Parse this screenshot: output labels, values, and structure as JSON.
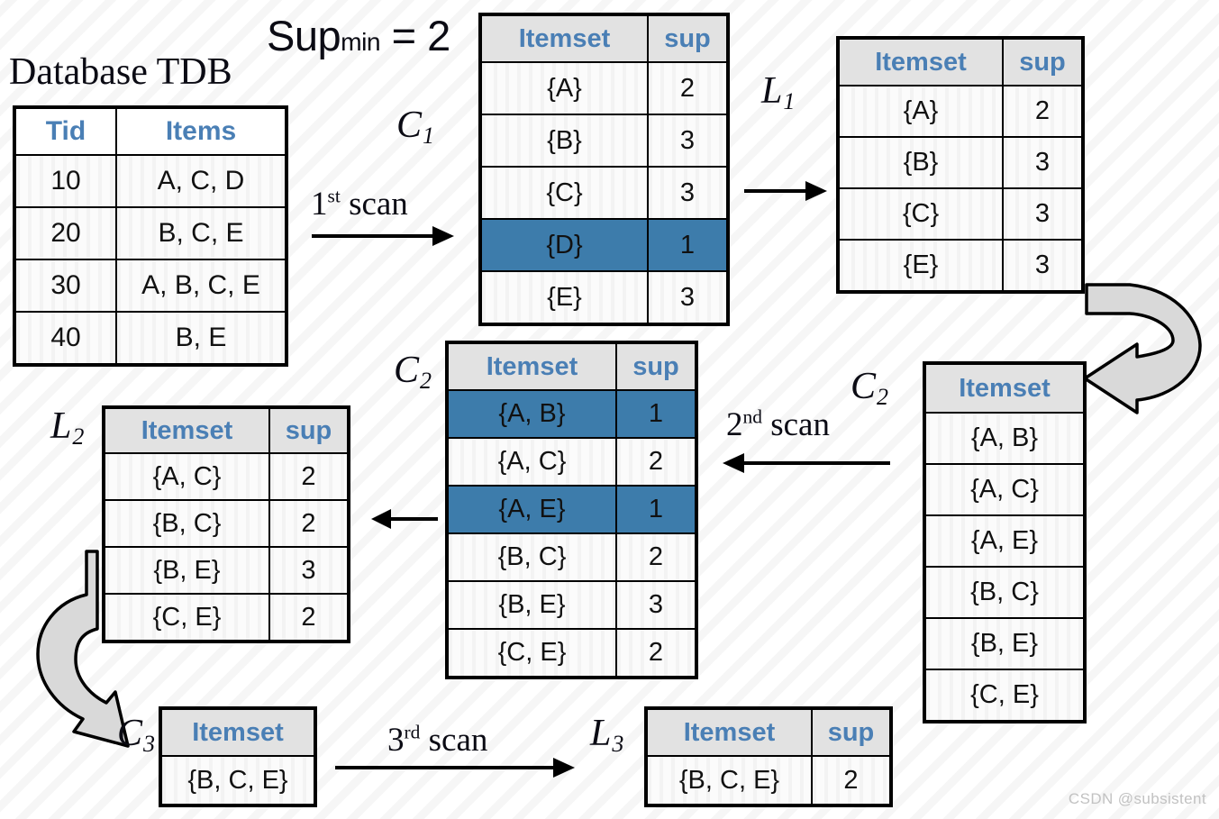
{
  "headline": {
    "database_title": "Database TDB",
    "supmin_text": "Sup",
    "supmin_sub": "min",
    "supmin_eq": " = 2"
  },
  "labels": {
    "c1": "C",
    "c1_sub": "1",
    "l1": "L",
    "l1_sub": "1",
    "c2_mid": "C",
    "c2_mid_sub": "2",
    "c2_right": "C",
    "c2_right_sub": "2",
    "l2": "L",
    "l2_sub": "2",
    "c3": "C",
    "c3_sub": "3",
    "l3": "L",
    "l3_sub": "3"
  },
  "scans": {
    "first": "1",
    "first_sup": "st",
    "first_rest": " scan",
    "second": "2",
    "second_sup": "nd",
    "second_rest": " scan",
    "third": "3",
    "third_sup": "rd",
    "third_rest": " scan"
  },
  "tdb": {
    "headers": [
      "Tid",
      "Items"
    ],
    "rows": [
      {
        "tid": "10",
        "items": "A, C, D"
      },
      {
        "tid": "20",
        "items": "B, C, E"
      },
      {
        "tid": "30",
        "items": "A, B, C, E"
      },
      {
        "tid": "40",
        "items": "B, E"
      }
    ]
  },
  "c1_table": {
    "headers": [
      "Itemset",
      "sup"
    ],
    "rows": [
      {
        "itemset": "{A}",
        "sup": "2",
        "pruned": false
      },
      {
        "itemset": "{B}",
        "sup": "3",
        "pruned": false
      },
      {
        "itemset": "{C}",
        "sup": "3",
        "pruned": false
      },
      {
        "itemset": "{D}",
        "sup": "1",
        "pruned": true
      },
      {
        "itemset": "{E}",
        "sup": "3",
        "pruned": false
      }
    ]
  },
  "l1_table": {
    "headers": [
      "Itemset",
      "sup"
    ],
    "rows": [
      {
        "itemset": "{A}",
        "sup": "2",
        "pruned": false
      },
      {
        "itemset": "{B}",
        "sup": "3",
        "pruned": false
      },
      {
        "itemset": "{C}",
        "sup": "3",
        "pruned": false
      },
      {
        "itemset": "{E}",
        "sup": "3",
        "pruned": false
      }
    ]
  },
  "c2_counted_table": {
    "headers": [
      "Itemset",
      "sup"
    ],
    "rows": [
      {
        "itemset": "{A, B}",
        "sup": "1",
        "pruned": true
      },
      {
        "itemset": "{A, C}",
        "sup": "2",
        "pruned": false
      },
      {
        "itemset": "{A, E}",
        "sup": "1",
        "pruned": true
      },
      {
        "itemset": "{B, C}",
        "sup": "2",
        "pruned": false
      },
      {
        "itemset": "{B, E}",
        "sup": "3",
        "pruned": false
      },
      {
        "itemset": "{C, E}",
        "sup": "2",
        "pruned": false
      }
    ]
  },
  "c2_candidate_table": {
    "headers": [
      "Itemset"
    ],
    "rows": [
      {
        "itemset": "{A, B}"
      },
      {
        "itemset": "{A, C}"
      },
      {
        "itemset": "{A, E}"
      },
      {
        "itemset": "{B, C}"
      },
      {
        "itemset": "{B, E}"
      },
      {
        "itemset": "{C, E}"
      }
    ]
  },
  "l2_table": {
    "headers": [
      "Itemset",
      "sup"
    ],
    "rows": [
      {
        "itemset": "{A, C}",
        "sup": "2"
      },
      {
        "itemset": "{B, C}",
        "sup": "2"
      },
      {
        "itemset": "{B, E}",
        "sup": "3"
      },
      {
        "itemset": "{C, E}",
        "sup": "2"
      }
    ]
  },
  "c3_table": {
    "headers": [
      "Itemset"
    ],
    "rows": [
      {
        "itemset": "{B, C, E}"
      }
    ]
  },
  "l3_table": {
    "headers": [
      "Itemset",
      "sup"
    ],
    "rows": [
      {
        "itemset": "{B, C, E}",
        "sup": "2"
      }
    ]
  },
  "watermark": "CSDN @subsistent",
  "colors": {
    "pruned_highlight": "#3d7cab",
    "header_text": "#4a7fb5",
    "header_bg": "#e2e2e2",
    "cell_bg": "#fbfbfb",
    "border": "#000000",
    "curved_arrow_fill": "#d9d9d9"
  }
}
